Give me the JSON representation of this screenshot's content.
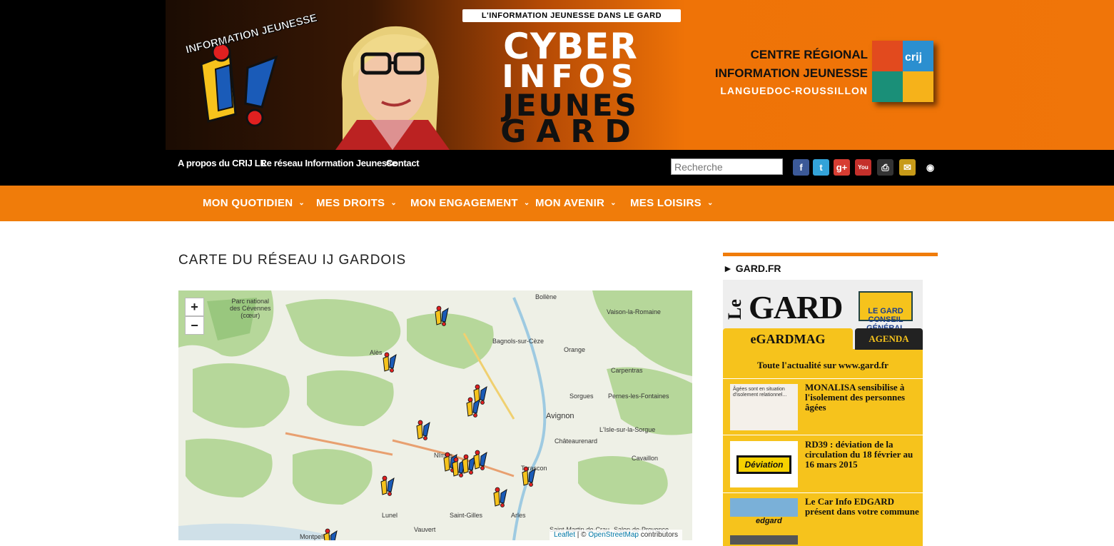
{
  "header": {
    "ij_logo_text": "INFORMATION JEUNESSE",
    "tagline": "L'INFORMATION JEUNESSE DANS LE GARD",
    "title_lines": [
      "CYBER",
      "INFOS",
      "JEUNES",
      "GARD"
    ],
    "crij_lines": [
      "CENTRE RÉGIONAL",
      "INFORMATION JEUNESSE",
      "LANGUEDOC-ROUSSILLON"
    ],
    "crij_logo_text": "crij",
    "colors": {
      "orange": "#f07c0a",
      "black": "#000000"
    }
  },
  "topbar": {
    "links": [
      "A propos du CRIJ LR",
      "Le réseau Information Jeunesse",
      "Contact"
    ],
    "search_placeholder": "Recherche",
    "social": [
      {
        "name": "facebook-icon",
        "glyph": "f",
        "color": "#3b5998"
      },
      {
        "name": "twitter-icon",
        "glyph": "t",
        "color": "#33a3d9"
      },
      {
        "name": "googleplus-icon",
        "glyph": "g+",
        "color": "#d73d32"
      },
      {
        "name": "youtube-icon",
        "glyph": "You",
        "color": "#c4302b"
      },
      {
        "name": "print-icon",
        "glyph": "⎙",
        "color": "#333"
      },
      {
        "name": "email-icon",
        "glyph": "✉",
        "color": "#c79a18"
      },
      {
        "name": "rss-icon",
        "glyph": "◉",
        "color": "#000"
      }
    ]
  },
  "nav": {
    "items": [
      "MON QUOTIDIEN",
      "MES DROITS",
      "MON ENGAGEMENT",
      "MON AVENIR",
      "MES LOISIRS"
    ],
    "chevron": "⌄"
  },
  "main": {
    "title": "CARTE DU RÉSEAU IJ GARDOIS",
    "map": {
      "zoom_in": "+",
      "zoom_out": "−",
      "attribution_leaflet": "Leaflet",
      "attribution_sep": " | © ",
      "attribution_osm": "OpenStreetMap",
      "attribution_tail": " contributors",
      "towns": [
        "Parc national\ndes Cévennes\n(cœur)",
        "Bollène",
        "Vaison-la-Romaine",
        "Alès",
        "Bagnols-sur-Cèze",
        "Orange",
        "Carpentras",
        "Sorgues",
        "Pernes-les-Fontaines",
        "Avignon",
        "L'Isle-sur-la-Sorgue",
        "Châteaurenard",
        "Nîmes",
        "Cavaillon",
        "Tarascon",
        "Lunel",
        "Vauvert",
        "Saint-Gilles",
        "Arles",
        "Saint-Martin-de-Crau",
        "Salon-de-Provence",
        "Montpellier"
      ],
      "marker_count": 13
    }
  },
  "sidebar": {
    "heading": "► GARD.FR",
    "widget": {
      "le": "Le",
      "gard": "GARD",
      "cg": "LE GARD\nCONSEIL GÉNÉRAL",
      "tab_mag": "eGARDMAG",
      "tab_agenda": "AGENDA",
      "all_news": "Toute l'actualité sur www.gard.fr",
      "items": [
        {
          "title": "MONALISA sensibilise à l'isolement des personnes âgées",
          "thumb_text": "Âgées sont en situation d'isolement relationnel..."
        },
        {
          "title": "RD39 : déviation de la circulation du 18 février au 16 mars 2015",
          "thumb_text": "Déviation"
        },
        {
          "title": "Le Car Info EDGARD présent dans votre commune",
          "thumb_text": "edgard"
        }
      ]
    }
  }
}
